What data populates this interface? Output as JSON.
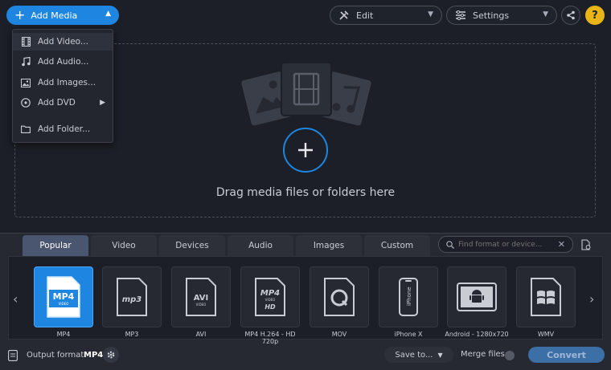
{
  "topbar": {
    "add_media_label": "Add Media",
    "edit_label": "Edit",
    "settings_label": "Settings",
    "help_label": "?"
  },
  "menu": {
    "items": [
      {
        "label": "Add Video...",
        "icon": "film-icon"
      },
      {
        "label": "Add Audio...",
        "icon": "music-note-icon"
      },
      {
        "label": "Add Images...",
        "icon": "image-icon"
      },
      {
        "label": "Add DVD",
        "icon": "disc-icon"
      },
      {
        "label": "Add Folder...",
        "icon": "folder-icon"
      }
    ]
  },
  "dropzone": {
    "text": "Drag media files or folders here"
  },
  "tabs": [
    {
      "label": "Popular",
      "active": true
    },
    {
      "label": "Video",
      "active": false
    },
    {
      "label": "Devices",
      "active": false
    },
    {
      "label": "Audio",
      "active": false
    },
    {
      "label": "Images",
      "active": false
    },
    {
      "label": "Custom",
      "active": false
    }
  ],
  "search": {
    "placeholder": "Find format or device..."
  },
  "formats": [
    {
      "label": "MP4",
      "badge": "MP4",
      "sub": "VIDEO",
      "selected": true
    },
    {
      "label": "MP3",
      "badge": "mp3"
    },
    {
      "label": "AVI",
      "badge": "AVI",
      "sub": "VIDEO"
    },
    {
      "label": "MP4 H.264 - HD 720p",
      "badge": "MP4",
      "sub": "VIDEO",
      "extra": "HD"
    },
    {
      "label": "MOV",
      "badge": "Q"
    },
    {
      "label": "iPhone X",
      "badge": "iPhone"
    },
    {
      "label": "Android - 1280x720"
    },
    {
      "label": "WMV"
    }
  ],
  "footer": {
    "output_label": "Output format:",
    "output_value": "MP4",
    "save_to_label": "Save to...",
    "merge_label": "Merge files:",
    "convert_label": "Convert"
  },
  "colors": {
    "accent": "#1e86e0",
    "help": "#e8b516",
    "background": "#1c1f27"
  }
}
